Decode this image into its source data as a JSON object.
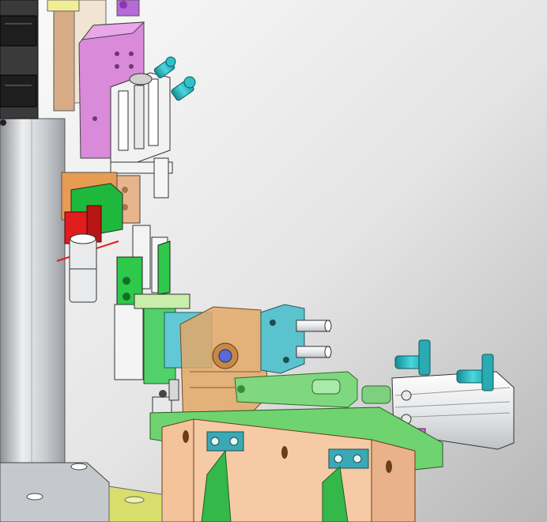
{
  "scene": {
    "kind": "3d-cad-render",
    "subject": "pneumatic-pick-and-place-fixture-assembly",
    "colors": {
      "background_light": "#f7f7f7",
      "background_dark": "#b9b9b9",
      "column_steel": "#c9ccd0",
      "slide_rail": "#2b2b2b",
      "magenta_block": "#d98ad9",
      "gripper_body": "#f0f0f0",
      "tan_block": "#e6b58c",
      "orange_block": "#e8a25c",
      "translucent_orange": "#e0a86a",
      "green_part": "#2ec84a",
      "light_green": "#7fd77f",
      "red_sensor": "#e02020",
      "cyan_fitting": "#27c7cf",
      "teal_block": "#5fc6d0",
      "olive_base": "#d9e06c",
      "dark_teal": "#2a6c74",
      "pink_block": "#d66bd6",
      "cylinder_silver": "#eef0f2"
    },
    "icons": [
      "gripper-icon",
      "air-cylinder-icon",
      "pneumatic-fitting-icon",
      "linear-rail-icon",
      "sensor-icon"
    ]
  }
}
